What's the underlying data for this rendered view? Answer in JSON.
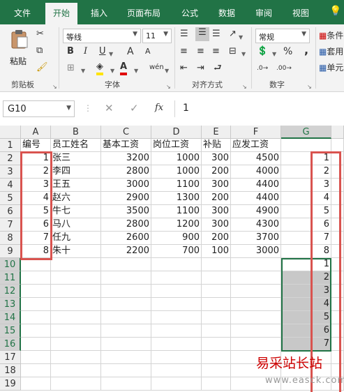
{
  "ribbon_tabs": [
    "文件",
    "开始",
    "插入",
    "页面布局",
    "公式",
    "数据",
    "审阅",
    "视图"
  ],
  "active_tab": "开始",
  "clipboard": {
    "paste_label": "粘贴",
    "group_label": "剪贴板"
  },
  "font": {
    "family": "等线",
    "size": "11",
    "group_label": "字体",
    "bold": "B",
    "italic": "I",
    "underline": "U",
    "grow": "A",
    "shrink": "A",
    "phonetic": "wén"
  },
  "alignment": {
    "group_label": "对齐方式"
  },
  "number": {
    "format": "常规",
    "group_label": "数字",
    "percent": "%",
    "comma": ","
  },
  "styles": {
    "items": [
      "条件",
      "套用",
      "单元"
    ]
  },
  "formula_bar": {
    "name_box": "G10",
    "fx": "fx",
    "value": "1"
  },
  "columns": [
    "A",
    "B",
    "C",
    "D",
    "E",
    "F",
    "G"
  ],
  "row_numbers": [
    "1",
    "2",
    "3",
    "4",
    "5",
    "6",
    "7",
    "8",
    "9",
    "10",
    "11",
    "12",
    "13",
    "14",
    "15",
    "16",
    "17",
    "18",
    "19"
  ],
  "headers": [
    "编号",
    "员工姓名",
    "基本工资",
    "岗位工资",
    "补贴",
    "应发工资"
  ],
  "rows": [
    {
      "id": "1",
      "name": "张三",
      "base": "3200",
      "post": "1000",
      "allow": "300",
      "pay": "4500",
      "g": "1"
    },
    {
      "id": "2",
      "name": "李四",
      "base": "2800",
      "post": "1000",
      "allow": "200",
      "pay": "4000",
      "g": "2"
    },
    {
      "id": "3",
      "name": "王五",
      "base": "3000",
      "post": "1100",
      "allow": "300",
      "pay": "4400",
      "g": "3"
    },
    {
      "id": "4",
      "name": "赵六",
      "base": "2900",
      "post": "1300",
      "allow": "200",
      "pay": "4400",
      "g": "4"
    },
    {
      "id": "5",
      "name": "牛七",
      "base": "3500",
      "post": "1100",
      "allow": "300",
      "pay": "4900",
      "g": "5"
    },
    {
      "id": "6",
      "name": "马八",
      "base": "2800",
      "post": "1200",
      "allow": "300",
      "pay": "4300",
      "g": "6"
    },
    {
      "id": "7",
      "name": "任九",
      "base": "2600",
      "post": "900",
      "allow": "200",
      "pay": "3700",
      "g": "7"
    },
    {
      "id": "8",
      "name": "朱十",
      "base": "2200",
      "post": "700",
      "allow": "100",
      "pay": "3000",
      "g": "8"
    }
  ],
  "g_fill": [
    "1",
    "2",
    "3",
    "4",
    "5",
    "6",
    "7"
  ],
  "colors": {
    "excel_green": "#217346",
    "highlight_red": "#d9534f",
    "selection_gray": "#c8c8c8"
  },
  "watermark": {
    "title": "易采站长站",
    "url": "www.easck.com"
  }
}
